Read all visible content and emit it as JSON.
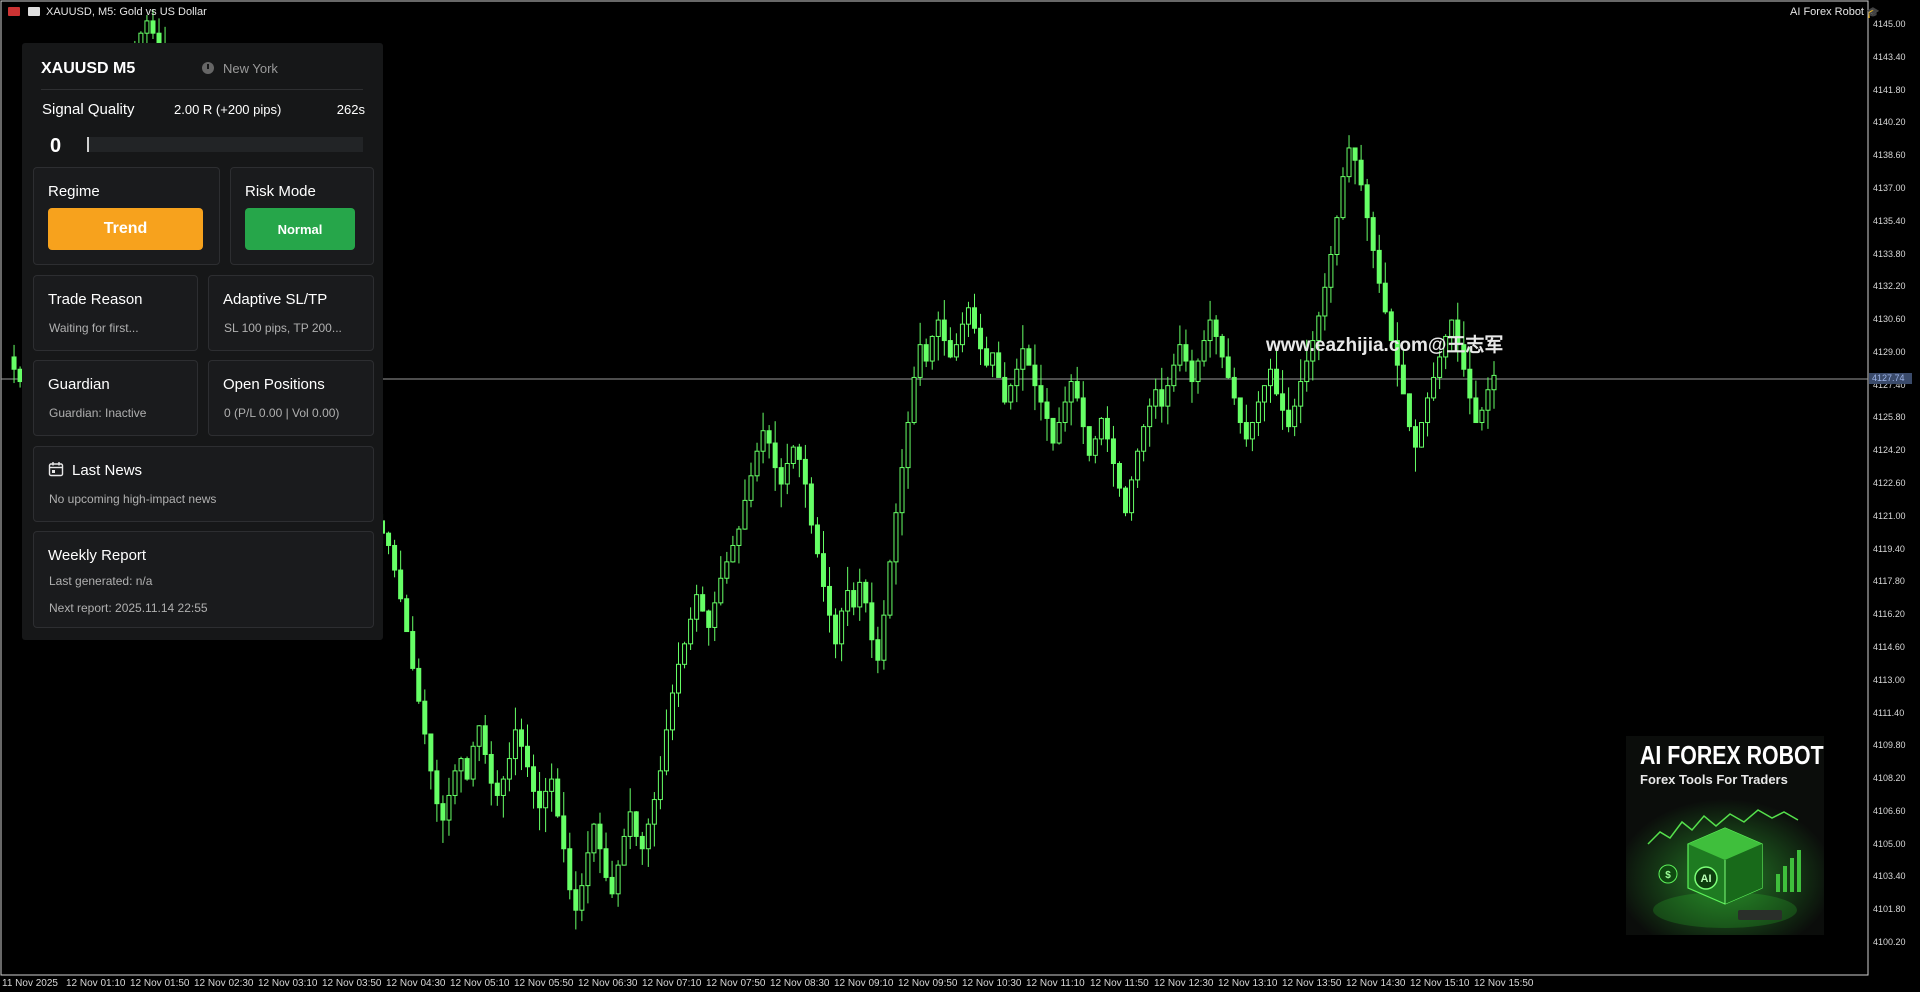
{
  "window": {
    "title": "XAUUSD, M5:  Gold vs US Dollar",
    "robot_label": "AI Forex Robot"
  },
  "panel": {
    "symbol": "XAUUSD M5",
    "session": "New York",
    "signal_quality": {
      "label": "Signal Quality",
      "value": "2.00 R (+200 pips)",
      "timer": "262s",
      "score": "0",
      "score_fraction": 0
    },
    "regime": {
      "label": "Regime",
      "value": "Trend",
      "color": "#f7a21d"
    },
    "risk_mode": {
      "label": "Risk Mode",
      "value": "Normal",
      "color": "#26a64a"
    },
    "trade_reason": {
      "label": "Trade Reason",
      "text": "Waiting for first..."
    },
    "adaptive": {
      "label": "Adaptive SL/TP",
      "text": "SL 100 pips, TP 200..."
    },
    "guardian": {
      "label": "Guardian",
      "text": "Guardian: Inactive"
    },
    "open_positions": {
      "label": "Open Positions",
      "text": "0 (P/L 0.00 | Vol 0.00)"
    },
    "news": {
      "label": "Last News",
      "text": "No upcoming high-impact news",
      "icon": "calendar-icon"
    },
    "weekly": {
      "label": "Weekly Report",
      "generated": "Last generated: n/a",
      "next": "Next report: 2025.11.14 22:55"
    }
  },
  "watermark": "www.eazhijia.com@王志军",
  "ad": {
    "title": "AI FOREX ROBOT",
    "subtitle": "Forex Tools For Traders",
    "cube_label": "AI",
    "colors": {
      "accent": "#39d33b"
    }
  },
  "current_price": "4127.74",
  "chart_data": {
    "type": "candlestick",
    "symbol": "XAUUSD",
    "timeframe": "M5",
    "y_ticks": [
      "4145.00",
      "4143.40",
      "4141.80",
      "4140.20",
      "4138.60",
      "4137.00",
      "4135.40",
      "4133.80",
      "4132.20",
      "4130.60",
      "4129.00",
      "4127.40",
      "4125.80",
      "4124.20",
      "4122.60",
      "4121.00",
      "4119.40",
      "4117.80",
      "4116.20",
      "4114.60",
      "4113.00",
      "4111.40",
      "4109.80",
      "4108.20",
      "4106.60",
      "4105.00",
      "4103.40",
      "4101.80",
      "4100.20"
    ],
    "x_ticks": [
      "11 Nov 2025",
      "12 Nov 01:10",
      "12 Nov 01:50",
      "12 Nov 02:30",
      "12 Nov 03:10",
      "12 Nov 03:50",
      "12 Nov 04:30",
      "12 Nov 05:10",
      "12 Nov 05:50",
      "12 Nov 06:30",
      "12 Nov 07:10",
      "12 Nov 07:50",
      "12 Nov 08:30",
      "12 Nov 09:10",
      "12 Nov 09:50",
      "12 Nov 10:30",
      "12 Nov 11:10",
      "12 Nov 11:50",
      "12 Nov 12:30",
      "12 Nov 13:10",
      "12 Nov 13:50",
      "12 Nov 14:30",
      "12 Nov 15:10",
      "12 Nov 15:50"
    ],
    "ylim": [
      4099.3,
      4145.8
    ],
    "candle_color": "#66ff66",
    "grid": false,
    "close_path": [
      4128.8,
      4128.2,
      4127.6,
      4128.6,
      4129.4,
      4130.2,
      4131.4,
      4132.4,
      4133.6,
      4134.8,
      4135.8,
      4136.8,
      4137.6,
      4138.4,
      4139.0,
      4139.6,
      4140.2,
      4140.8,
      4141.6,
      4142.4,
      4143.0,
      4143.8,
      4144.6,
      4145.2,
      4144.6,
      4144.0,
      4143.2,
      4142.4,
      4141.4,
      4140.4,
      4139.4,
      4138.4,
      4137.4,
      4136.4,
      4135.6,
      4134.8,
      4133.8,
      4132.8,
      4131.8,
      4130.8,
      4129.8,
      4128.8,
      4128.0,
      4127.4,
      4126.6,
      4126.0,
      4125.4,
      4124.6,
      4123.6,
      4122.6,
      4121.4,
      4120.4,
      4121.8,
      4122.8,
      4123.4,
      4122.4,
      4121.6,
      4121.0,
      4120.2,
      4120.8,
      4121.4,
      4120.8,
      4120.2,
      4119.6,
      4118.4,
      4117.0,
      4115.4,
      4113.6,
      4112.0,
      4110.4,
      4108.6,
      4107.0,
      4106.2,
      4107.4,
      4108.6,
      4109.2,
      4108.2,
      4109.8,
      4110.8,
      4109.4,
      4108.0,
      4107.4,
      4108.2,
      4109.2,
      4110.6,
      4109.8,
      4108.8,
      4107.6,
      4106.8,
      4107.6,
      4108.2,
      4106.4,
      4104.8,
      4102.8,
      4101.8,
      4103.0,
      4104.6,
      4106.0,
      4104.8,
      4103.4,
      4102.6,
      4104.0,
      4105.4,
      4106.6,
      4105.4,
      4104.8,
      4106.0,
      4107.2,
      4108.6,
      4110.6,
      4112.4,
      4113.8,
      4114.8,
      4116.0,
      4117.2,
      4116.4,
      4115.6,
      4116.8,
      4118.0,
      4118.8,
      4119.6,
      4120.4,
      4121.8,
      4123.0,
      4124.2,
      4125.2,
      4124.6,
      4123.4,
      4122.6,
      4123.6,
      4124.4,
      4123.8,
      4122.6,
      4120.6,
      4119.2,
      4117.6,
      4116.2,
      4114.8,
      4116.4,
      4117.4,
      4116.6,
      4117.8,
      4116.8,
      4115.0,
      4114.0,
      4116.2,
      4118.8,
      4121.2,
      4123.4,
      4125.6,
      4127.8,
      4129.4,
      4128.6,
      4129.8,
      4130.6,
      4129.6,
      4128.8,
      4129.4,
      4130.4,
      4131.2,
      4130.2,
      4129.2,
      4128.4,
      4129.0,
      4127.8,
      4126.6,
      4127.4,
      4128.2,
      4129.2,
      4128.4,
      4127.4,
      4126.6,
      4125.8,
      4124.6,
      4125.6,
      4126.6,
      4127.6,
      4126.8,
      4125.4,
      4124.0,
      4124.8,
      4125.8,
      4124.8,
      4123.6,
      4122.4,
      4121.2,
      4122.8,
      4124.2,
      4125.4,
      4126.4,
      4127.2,
      4126.4,
      4127.4,
      4128.4,
      4129.4,
      4128.6,
      4127.6,
      4128.6,
      4129.6,
      4130.6,
      4129.8,
      4128.8,
      4127.8,
      4126.8,
      4125.6,
      4124.8,
      4125.6,
      4126.6,
      4127.4,
      4128.2,
      4127.0,
      4126.2,
      4125.4,
      4126.4,
      4127.6,
      4128.6,
      4129.6,
      4130.8,
      4132.2,
      4133.8,
      4135.6,
      4137.6,
      4139.0,
      4138.4,
      4137.2,
      4135.6,
      4134.0,
      4132.4,
      4131.0,
      4129.6,
      4128.4,
      4127.0,
      4125.4,
      4124.4,
      4125.6,
      4126.8,
      4127.8,
      4128.8,
      4129.8,
      4130.6,
      4129.4,
      4128.2,
      4126.8,
      4125.6,
      4126.2,
      4127.2,
      4127.9
    ]
  }
}
